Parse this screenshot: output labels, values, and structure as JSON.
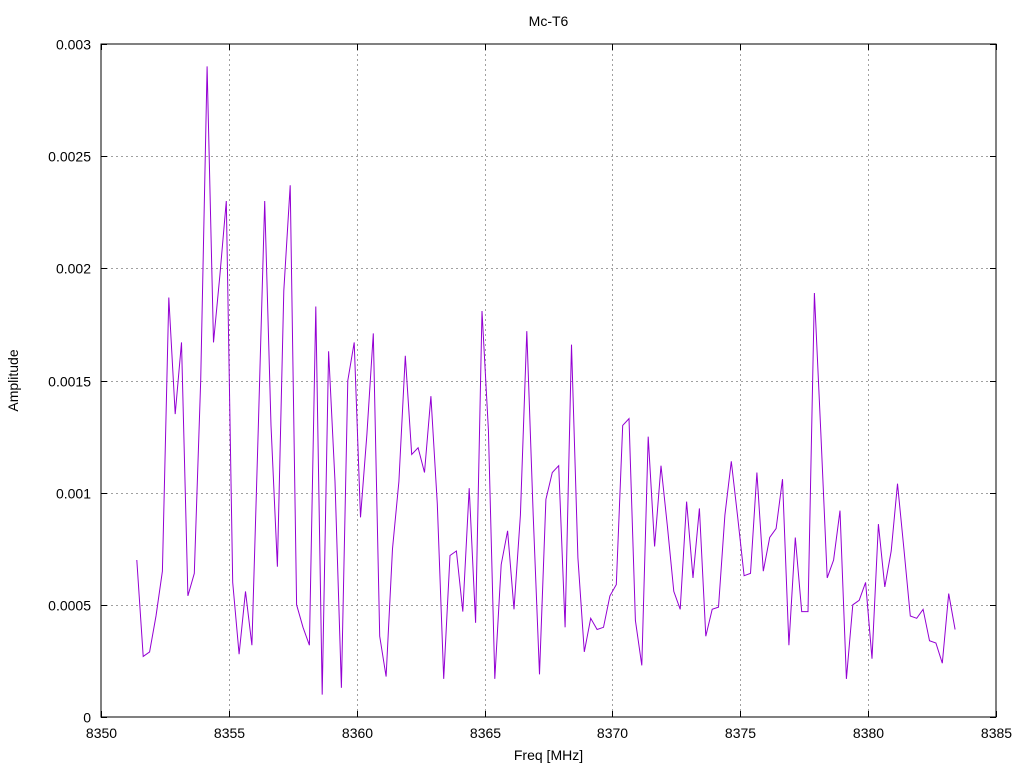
{
  "chart_data": {
    "type": "line",
    "title": "Mc-T6",
    "xlabel": "Freq [MHz]",
    "ylabel": "Amplitude",
    "xlim": [
      8350,
      8385
    ],
    "ylim": [
      0,
      0.003
    ],
    "xticks": [
      8350,
      8355,
      8360,
      8365,
      8370,
      8375,
      8380,
      8385
    ],
    "xtick_labels": [
      "8350",
      "8355",
      "8360",
      "8365",
      "8370",
      "8375",
      "8380",
      "8385"
    ],
    "yticks": [
      0,
      0.0005,
      0.001,
      0.0015,
      0.002,
      0.0025,
      0.003
    ],
    "ytick_labels": [
      "0",
      "0.0005",
      "0.001",
      "0.0015",
      "0.002",
      "0.0025",
      "0.003"
    ],
    "grid": true,
    "line_color": "#9400d3",
    "series": [
      {
        "x": [
          8351.4,
          8351.65,
          8351.9,
          8352.15,
          8352.4,
          8352.65,
          8352.9,
          8353.15,
          8353.4,
          8353.65,
          8353.9,
          8354.15,
          8354.4,
          8354.65,
          8354.9,
          8355.15,
          8355.4,
          8355.65,
          8355.9,
          8356.15,
          8356.4,
          8356.65,
          8356.9,
          8357.15,
          8357.4,
          8357.65,
          8357.9,
          8358.15,
          8358.4,
          8358.65,
          8358.9,
          8359.15,
          8359.4,
          8359.65,
          8359.9,
          8360.15,
          8360.4,
          8360.65,
          8360.9,
          8361.15,
          8361.4,
          8361.65,
          8361.9,
          8362.15,
          8362.4,
          8362.65,
          8362.9,
          8363.15,
          8363.4,
          8363.65,
          8363.9,
          8364.15,
          8364.4,
          8364.65,
          8364.9,
          8365.15,
          8365.4,
          8365.65,
          8365.9,
          8366.15,
          8366.4,
          8366.65,
          8366.9,
          8367.15,
          8367.4,
          8367.65,
          8367.9,
          8368.15,
          8368.4,
          8368.65,
          8368.9,
          8369.15,
          8369.4,
          8369.65,
          8369.9,
          8370.15,
          8370.4,
          8370.65,
          8370.9,
          8371.15,
          8371.4,
          8371.65,
          8371.9,
          8372.15,
          8372.4,
          8372.65,
          8372.9,
          8373.15,
          8373.4,
          8373.65,
          8373.9,
          8374.15,
          8374.4,
          8374.65,
          8374.9,
          8375.15,
          8375.4,
          8375.65,
          8375.9,
          8376.15,
          8376.4,
          8376.65,
          8376.9,
          8377.15,
          8377.4,
          8377.65,
          8377.9,
          8378.15,
          8378.4,
          8378.65,
          8378.9,
          8379.15,
          8379.4,
          8379.65,
          8379.9,
          8380.15,
          8380.4,
          8380.65,
          8380.9,
          8381.15,
          8381.4,
          8381.65,
          8381.9,
          8382.15,
          8382.4,
          8382.65,
          8382.9,
          8383.15,
          8383.4
        ],
        "y": [
          0.0007,
          0.00027,
          0.00029,
          0.00045,
          0.00065,
          0.00187,
          0.00135,
          0.00167,
          0.00054,
          0.00064,
          0.0015,
          0.0029,
          0.00167,
          0.00197,
          0.0023,
          0.0006,
          0.00028,
          0.00056,
          0.00032,
          0.00129,
          0.0023,
          0.0013,
          0.00067,
          0.0019,
          0.00237,
          0.0005,
          0.0004,
          0.00032,
          0.00183,
          0.0001,
          0.00163,
          0.00105,
          0.00013,
          0.0015,
          0.00167,
          0.00089,
          0.00126,
          0.00171,
          0.00036,
          0.00018,
          0.00075,
          0.00105,
          0.00161,
          0.00117,
          0.0012,
          0.00109,
          0.00143,
          0.00095,
          0.00017,
          0.00072,
          0.00074,
          0.00047,
          0.00102,
          0.00042,
          0.00181,
          0.00128,
          0.00017,
          0.00068,
          0.00083,
          0.00048,
          0.0009,
          0.00172,
          0.0009,
          0.00019,
          0.00097,
          0.00109,
          0.00112,
          0.0004,
          0.00166,
          0.00071,
          0.00029,
          0.00044,
          0.00039,
          0.0004,
          0.00054,
          0.00059,
          0.0013,
          0.00133,
          0.00043,
          0.00023,
          0.00125,
          0.00076,
          0.00112,
          0.00085,
          0.00056,
          0.00048,
          0.00096,
          0.00062,
          0.00093,
          0.00036,
          0.00048,
          0.00049,
          0.0009,
          0.00114,
          0.00089,
          0.00063,
          0.00064,
          0.00109,
          0.00065,
          0.0008,
          0.00084,
          0.00106,
          0.00032,
          0.0008,
          0.00047,
          0.00047,
          0.00189,
          0.00127,
          0.00062,
          0.0007,
          0.00092,
          0.00017,
          0.0005,
          0.00052,
          0.0006,
          0.00026,
          0.00086,
          0.00058,
          0.00074,
          0.00104,
          0.00075,
          0.00045,
          0.00044,
          0.00048,
          0.00034,
          0.00033,
          0.00024,
          0.00055,
          0.00039
        ]
      }
    ]
  }
}
